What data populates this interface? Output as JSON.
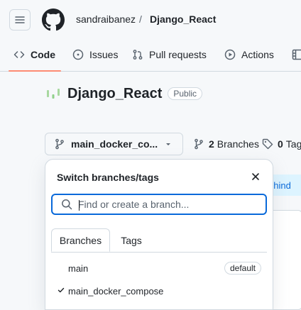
{
  "header": {
    "owner": "sandraibanez",
    "separator": "/",
    "repo": "Django_React",
    "tabs": [
      {
        "label": "Code",
        "icon": "code-icon"
      },
      {
        "label": "Issues",
        "icon": "issue-icon"
      },
      {
        "label": "Pull requests",
        "icon": "pull-request-icon"
      },
      {
        "label": "Actions",
        "icon": "play-icon"
      }
    ]
  },
  "repo": {
    "name": "Django_React",
    "visibility": "Public"
  },
  "toolbar": {
    "current_branch": "main_docker_co...",
    "branches_count": "2",
    "branches_label": "Branches",
    "tags_count": "0",
    "tags_label": "Tag",
    "behind_text": "ehind"
  },
  "branch_popover": {
    "title": "Switch branches/tags",
    "search_placeholder": "Find or create a branch...",
    "tabs": [
      "Branches",
      "Tags"
    ],
    "items": [
      {
        "name": "main",
        "badge": "default",
        "selected": false
      },
      {
        "name": "main_docker_compose",
        "badge": "",
        "selected": true
      }
    ]
  },
  "colors": {
    "accent": "#0969da",
    "underline": "#fd8c73",
    "border": "#d1d9e0"
  }
}
